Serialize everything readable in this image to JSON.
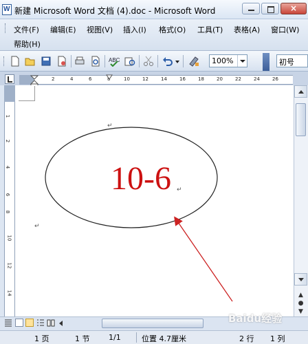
{
  "window": {
    "title": "新建 Microsoft Word 文档 (4).doc - Microsoft Word",
    "close_glyph": "×"
  },
  "menu": {
    "items": [
      "文件(F)",
      "编辑(E)",
      "视图(V)",
      "插入(I)",
      "格式(O)",
      "工具(T)",
      "表格(A)",
      "窗口(W)",
      "帮助(H)"
    ]
  },
  "toolbar": {
    "zoom": "100%",
    "style": "初号"
  },
  "ruler": {
    "ticks": [
      "2",
      "4",
      "6",
      "8",
      "10",
      "12",
      "14",
      "16",
      "18",
      "20",
      "22",
      "24",
      "26"
    ]
  },
  "vruler": {
    "ticks": [
      "1",
      "2",
      "4",
      "6",
      "8",
      "10",
      "12",
      "14"
    ]
  },
  "document": {
    "ellipse_text": "10-6",
    "paragraph_mark": "↵",
    "text_color": "#cc1111",
    "arrow_color": "#cc2222"
  },
  "status": {
    "page": "1 页",
    "section": "1 节",
    "page_of": "1/1",
    "position": "位置 4.7厘米",
    "line": "2 行",
    "column": "1 列"
  },
  "watermark": {
    "text": "Baidu经验"
  }
}
